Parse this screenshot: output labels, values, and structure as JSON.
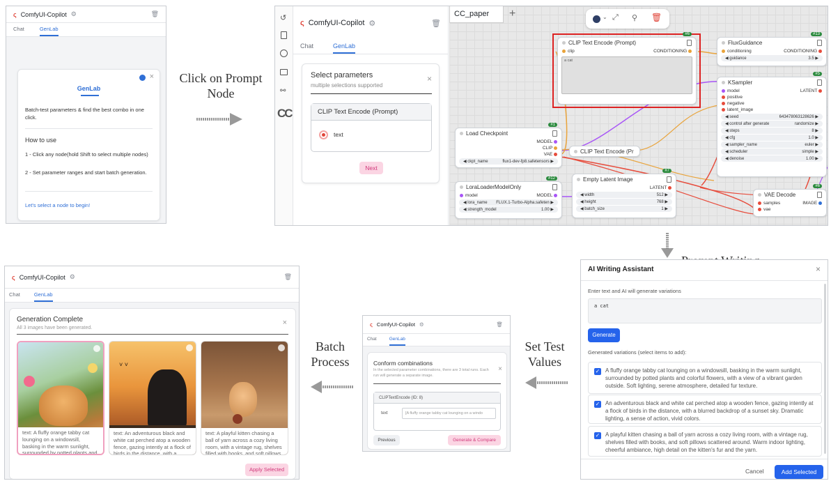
{
  "colors": {
    "brand": "#e0463a",
    "accent": "#2f6fd6",
    "pink": "#d0387a",
    "blue_button": "#2563eb"
  },
  "app": {
    "title": "ComfyUI-Copilot",
    "tab_chat": "Chat",
    "tab_genlab": "GenLab"
  },
  "panel1": {
    "card_title": "GenLab",
    "intro": "Batch-test parameters & find the best combo in one click.",
    "howto_title": "How to use",
    "step1": "1 - Click any node(hold Shift to select multiple nodes)",
    "step2": "2 - Set parameter ranges and start batch generation.",
    "link": "Let's select a node to begin!"
  },
  "arrow1": {
    "label": "Click on Prompt Node"
  },
  "panel2": {
    "title": "Select parameters",
    "subtitle": "multiple selections supported",
    "node_title": "CLIP Text Encode (Prompt)",
    "option": "text",
    "next": "Next"
  },
  "editor": {
    "tab": "CC_paper",
    "plus": "+",
    "sidebar_logo": "CC",
    "clip_node": {
      "title": "CLIP Text Encode (Prompt)",
      "badge": "#6",
      "in": "clip",
      "out": "CONDITIONING",
      "text": "a cat"
    },
    "flux": {
      "title": "FluxGuidance",
      "badge": "#13",
      "in": "conditioning",
      "out": "CONDITIONING",
      "w_label": "guidance",
      "w_value": "3.5"
    },
    "ksampler": {
      "title": "KSampler",
      "badge": "#5",
      "out": "LATENT",
      "inputs": [
        "model",
        "positive",
        "negative",
        "latent_image"
      ],
      "widgets": [
        {
          "label": "seed",
          "value": "643478063128626"
        },
        {
          "label": "control after generate",
          "value": "randomize"
        },
        {
          "label": "steps",
          "value": "8"
        },
        {
          "label": "cfg",
          "value": "1.0"
        },
        {
          "label": "sampler_name",
          "value": "euler"
        },
        {
          "label": "scheduler",
          "value": "simple"
        },
        {
          "label": "denoise",
          "value": "1.00"
        }
      ]
    },
    "checkpoint": {
      "title": "Load Checkpoint",
      "badge": "#1",
      "outs": [
        "MODEL",
        "CLIP",
        "VAE"
      ],
      "w_label": "ckpt_name",
      "w_value": "flux1-dev-fp8.safetensors"
    },
    "clip2": {
      "title": "CLIP Text Encode (Pr"
    },
    "lora": {
      "title": "LoraLoaderModelOnly",
      "badge": "#12",
      "in": "model",
      "out": "MODEL",
      "w1_label": "lora_name",
      "w1_value": "FLUX.1-Turbo-Alpha.safeten",
      "w2_label": "strength_model",
      "w2_value": "1.00"
    },
    "latent": {
      "title": "Empty Latent Image",
      "badge": "#7",
      "out": "LATENT",
      "widgets": [
        {
          "label": "width",
          "value": "512"
        },
        {
          "label": "height",
          "value": "768"
        },
        {
          "label": "batch_size",
          "value": "1"
        }
      ]
    },
    "vae": {
      "title": "VAE Decode",
      "badge": "#6",
      "in1": "samples",
      "in2": "vae",
      "out": "IMAGE"
    }
  },
  "arrow2": {
    "label": "Prompt Writing"
  },
  "writer": {
    "title": "AI Writing Assistant",
    "instruction": "Enter text and AI will generate variations",
    "input": "a cat",
    "generate": "Generate",
    "variations_label": "Generated variations (select items to add):",
    "variations": [
      "A fluffy orange tabby cat lounging on a windowsill, basking in the warm sunlight, surrounded by potted plants and colorful flowers, with a view of a vibrant garden outside. Soft lighting, serene atmosphere, detailed fur texture.",
      "An adventurous black and white cat perched atop a wooden fence, gazing intently at a flock of birds in the distance, with a blurred backdrop of a sunset sky. Dramatic lighting, a sense of action, vivid colors.",
      "A playful kitten chasing a ball of yarn across a cozy living room, with a vintage rug, shelves filled with books, and soft pillows scattered around. Warm indoor lighting, cheerful ambiance, high detail on the kitten's fur and the yarn."
    ],
    "cancel": "Cancel",
    "add": "Add Selected"
  },
  "arrow3": {
    "label": "Set Test Values"
  },
  "confirm": {
    "title": "Conform combinations",
    "desc": "In the selected parameter combinations, there are 3 total runs. Each run will generate a separate image.",
    "node": "CLIPTextEncode (ID: 8)",
    "field_label": "text",
    "field_value": "[A fluffy orange tabby cat lounging on a windo",
    "prev": "Previous",
    "gen": "Generate & Compare"
  },
  "arrow4": {
    "label": "Batch Process"
  },
  "result": {
    "title": "Generation Complete",
    "subtitle": "All 3 images have been generated.",
    "captions": [
      "text: A fluffy orange tabby cat lounging on a windowsill, basking in the warm sunlight, surrounded by potted plants and colorful",
      "text: An adventurous black and white cat perched atop a wooden fence, gazing intently at a flock of birds in the distance, with a blurred",
      "text: A playful kitten chasing a ball of yarn across a cozy living room, with a vintage rug, shelves filled with books, and soft pillows"
    ],
    "apply": "Apply Selected"
  }
}
